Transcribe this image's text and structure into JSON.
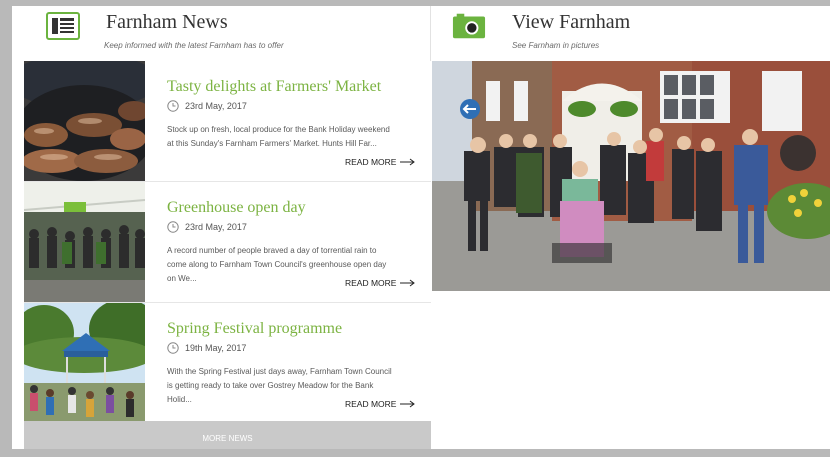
{
  "news_section": {
    "title": "Farnham News",
    "subtitle": "Keep informed with the latest Farnham has to offer",
    "icon": "newspaper-icon"
  },
  "view_section": {
    "title": "View Farnham",
    "subtitle": "See Farnham in pictures",
    "icon": "camera-icon"
  },
  "news_items": [
    {
      "title": "Tasty delights at Farmers' Market",
      "date": "23rd May, 2017",
      "excerpt": "Stock up on fresh, local produce for the Bank Holiday weekend at this Sunday's Farnham Farmers' Market. Hunts Hill Far...",
      "read_more": "READ MORE"
    },
    {
      "title": "Greenhouse open day",
      "date": "23rd May, 2017",
      "excerpt": "A record number of people braved a day of torrential rain to come along to Farnham Town Council's greenhouse open day on We...",
      "read_more": "READ MORE"
    },
    {
      "title": "Spring Festival programme",
      "date": "19th May, 2017",
      "excerpt": "With the Spring Festival just days away, Farnham Town Council is getting ready to take over Gostrey Meadow for the Bank Holid...",
      "read_more": "READ MORE"
    }
  ],
  "more_news_label": "MORE NEWS",
  "colors": {
    "accent_green": "#7cb342",
    "title_dark": "#333333",
    "more_news_bg": "#c9c9c9"
  }
}
